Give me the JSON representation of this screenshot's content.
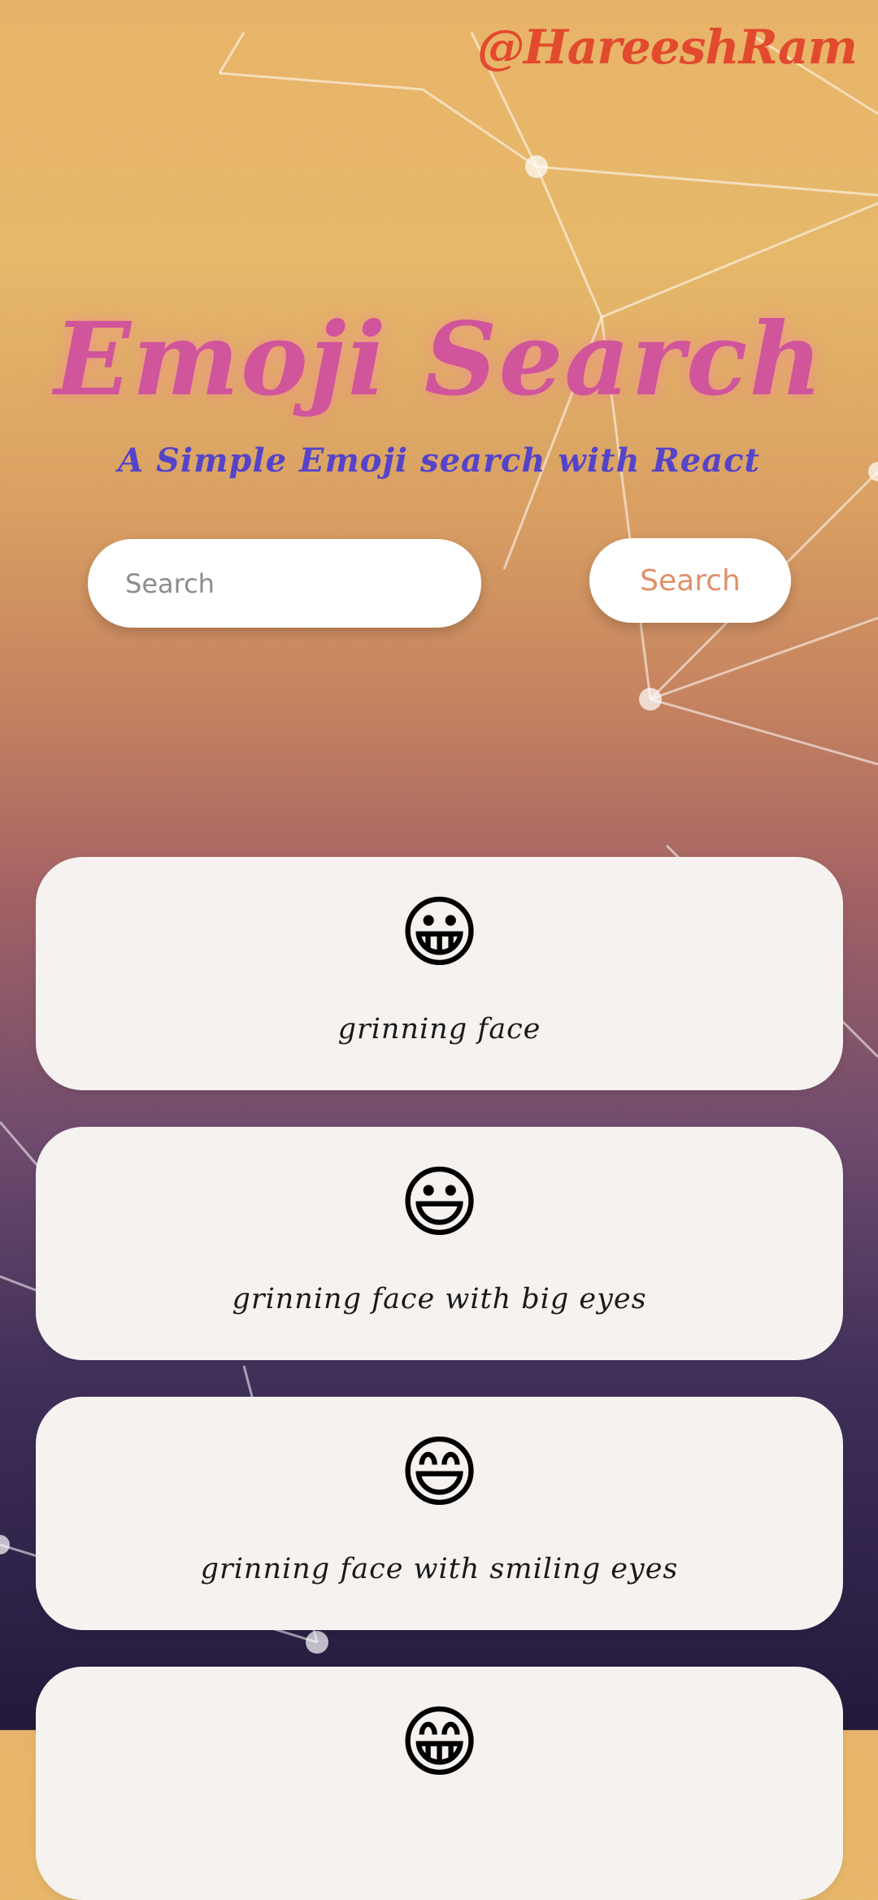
{
  "header": {
    "handle": "@HareeshRam"
  },
  "hero": {
    "title": "Emoji Search",
    "subtitle": "A Simple Emoji search with React"
  },
  "search": {
    "placeholder": "Search",
    "value": "",
    "button_label": "Search"
  },
  "results": [
    {
      "emoji": "😀",
      "name": "grinning face"
    },
    {
      "emoji": "😃",
      "name": "grinning face with big eyes"
    },
    {
      "emoji": "😄",
      "name": "grinning face with smiling eyes"
    },
    {
      "emoji": "😁",
      "name": ""
    }
  ],
  "colors": {
    "handle": "#e24a2e",
    "title": "#d0559b",
    "subtitle": "#5543c9",
    "button_text": "#e0906a",
    "card_bg": "#f5f2f0"
  }
}
